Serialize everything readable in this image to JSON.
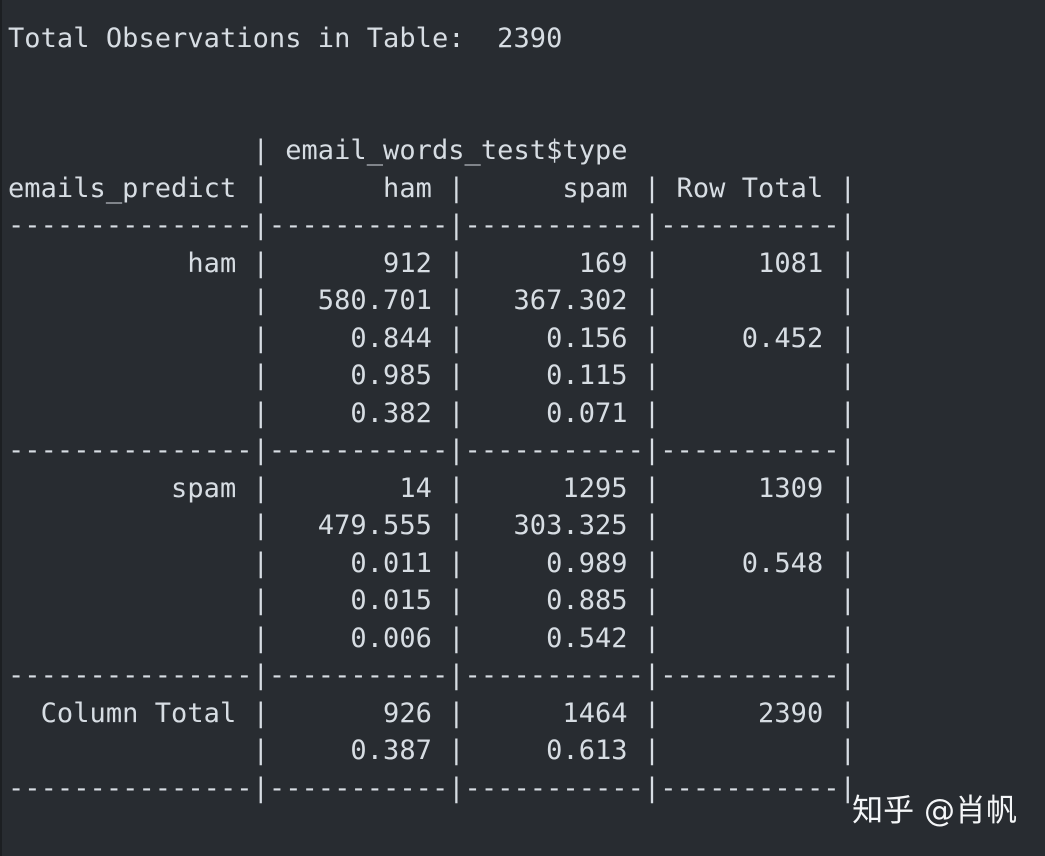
{
  "terminal": {
    "lines": [
      "Total Observations in Table:  2390",
      "",
      "",
      "               | email_words_test$type",
      "emails_predict |       ham |      spam | Row Total |",
      "---------------|-----------|-----------|-----------|",
      "           ham |       912 |       169 |      1081 |",
      "               |   580.701 |   367.302 |           |",
      "               |     0.844 |     0.156 |     0.452 |",
      "               |     0.985 |     0.115 |           |",
      "               |     0.382 |     0.071 |           |",
      "---------------|-----------|-----------|-----------|",
      "          spam |        14 |      1295 |      1309 |",
      "               |   479.555 |   303.325 |           |",
      "               |     0.011 |     0.989 |     0.548 |",
      "               |     0.015 |     0.885 |           |",
      "               |     0.006 |     0.542 |           |",
      "---------------|-----------|-----------|-----------|",
      "  Column Total |       926 |      1464 |      2390 |",
      "               |     0.387 |     0.613 |           |",
      "---------------|-----------|-----------|-----------|"
    ]
  },
  "watermark": {
    "text": "知乎 @肖帆"
  }
}
